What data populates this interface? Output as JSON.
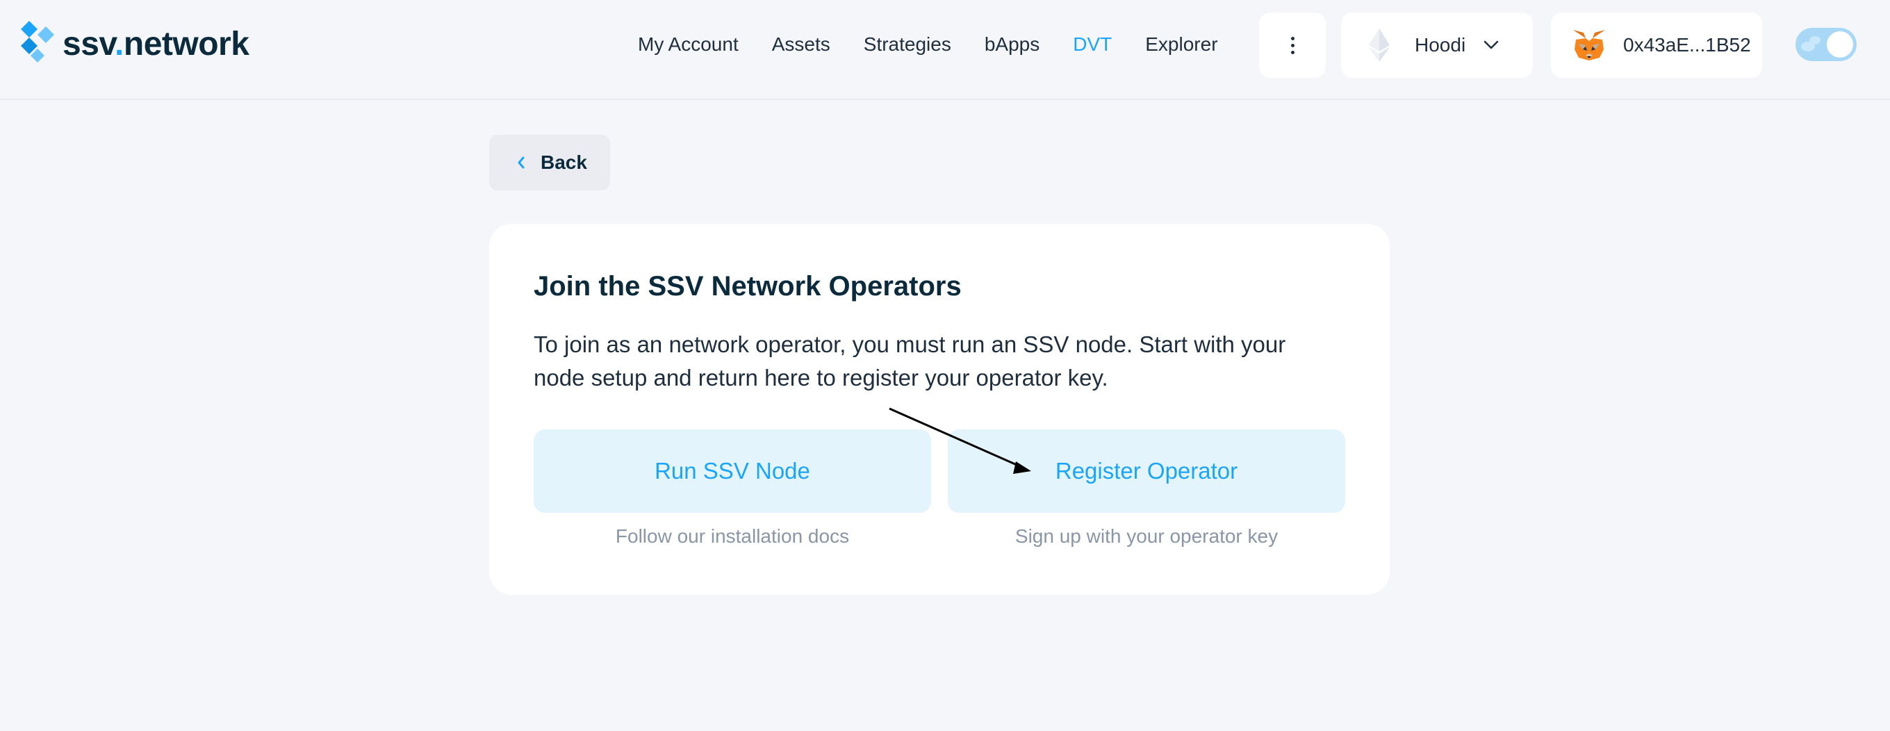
{
  "header": {
    "logo": {
      "name": "ssv",
      "dot": ".",
      "suffix": "network"
    },
    "nav": [
      {
        "label": "My Account",
        "active": false
      },
      {
        "label": "Assets",
        "active": false
      },
      {
        "label": "Strategies",
        "active": false
      },
      {
        "label": "bApps",
        "active": false
      },
      {
        "label": "DVT",
        "active": true
      },
      {
        "label": "Explorer",
        "active": false
      }
    ],
    "network": {
      "label": "Hoodi",
      "icon": "ethereum-icon"
    },
    "wallet": {
      "address": "0x43aE...1B52",
      "icon": "metamask-fox-icon"
    },
    "theme_toggle": {
      "icon": "theme-toggle",
      "state": "on"
    }
  },
  "back_button": {
    "label": "Back"
  },
  "card": {
    "title": "Join the SSV Network Operators",
    "description": "To join as an network operator, you must run an SSV node. Start with your node setup and return here to register your operator key.",
    "actions": [
      {
        "label": "Run SSV Node",
        "subtitle": "Follow our installation docs"
      },
      {
        "label": "Register Operator",
        "subtitle": "Sign up with your operator key"
      }
    ]
  },
  "colors": {
    "accent": "#1ba5f8",
    "background": "#f5f6fa",
    "card": "#ffffff",
    "action_bg": "#e4f4fd",
    "text_primary": "#0b2a3c",
    "text_muted": "#8a96a6"
  }
}
